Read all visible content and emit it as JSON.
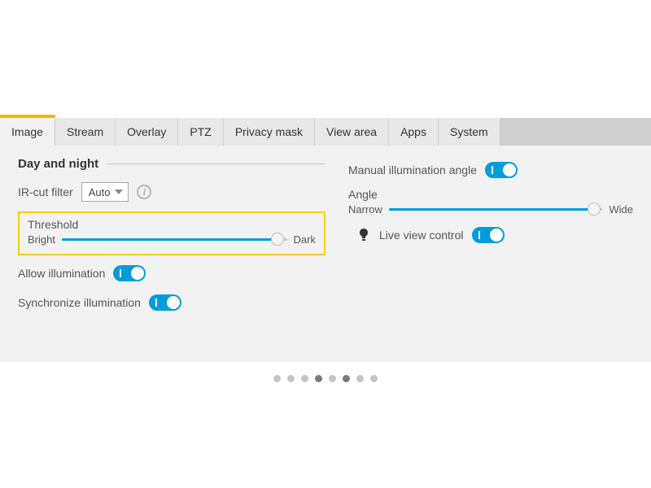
{
  "tabs": [
    "Image",
    "Stream",
    "Overlay",
    "PTZ",
    "Privacy mask",
    "View area",
    "Apps",
    "System"
  ],
  "active_tab_index": 0,
  "section": {
    "title": "Day and night"
  },
  "ircut": {
    "label": "IR-cut filter",
    "selected": "Auto"
  },
  "threshold": {
    "label": "Threshold",
    "min_label": "Bright",
    "max_label": "Dark",
    "percent": 96
  },
  "allow_illum": {
    "label": "Allow illumination",
    "on": true
  },
  "sync_illum": {
    "label": "Synchronize illumination",
    "on": true
  },
  "manual_angle": {
    "label": "Manual illumination angle",
    "on": true
  },
  "angle": {
    "label": "Angle",
    "min_label": "Narrow",
    "max_label": "Wide",
    "percent": 96
  },
  "live_view": {
    "label": "Live view control",
    "on": true
  },
  "pager": {
    "count": 8,
    "active": [
      3,
      5
    ]
  }
}
